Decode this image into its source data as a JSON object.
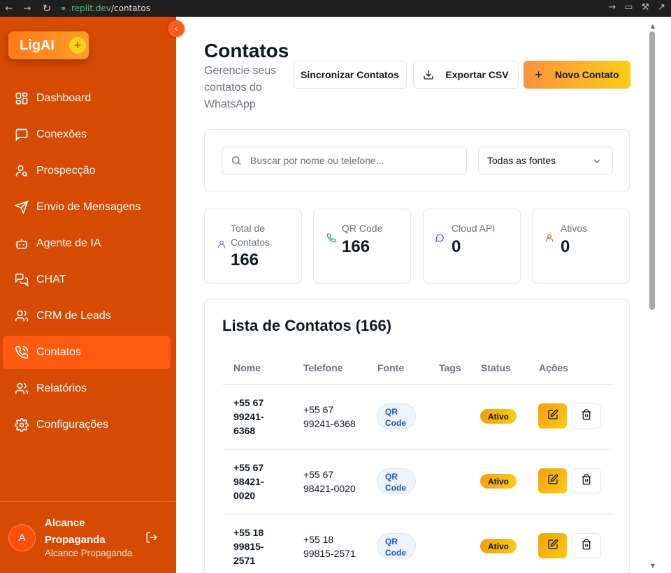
{
  "browser": {
    "url_domain": ".replit.dev",
    "url_path": "/contatos"
  },
  "sidebar": {
    "logo_text": "LigAI",
    "logo_badge": "+",
    "items": [
      {
        "label": "Dashboard",
        "icon": "layout-grid-icon"
      },
      {
        "label": "Conexões",
        "icon": "message-square-icon"
      },
      {
        "label": "Prospecção",
        "icon": "user-search-icon"
      },
      {
        "label": "Envio de Mensagens",
        "icon": "send-icon"
      },
      {
        "label": "Agente de IA",
        "icon": "bot-icon"
      },
      {
        "label": "CHAT",
        "icon": "messages-icon"
      },
      {
        "label": "CRM de Leads",
        "icon": "users-icon"
      },
      {
        "label": "Contatos",
        "icon": "phone-call-icon",
        "active": true
      },
      {
        "label": "Relatórios",
        "icon": "users-report-icon"
      },
      {
        "label": "Configurações",
        "icon": "gear-icon"
      }
    ],
    "user": {
      "initial": "A",
      "name": "Alcance Propaganda",
      "subtitle": "Alcance Propaganda"
    }
  },
  "header": {
    "title": "Contatos",
    "subtitle": "Gerencie seus contatos do WhatsApp",
    "btn_sync": "Sincronizar Contatos",
    "btn_csv": "Exportar CSV",
    "btn_new": "Novo Contato"
  },
  "filters": {
    "search_placeholder": "Buscar por nome ou telefone...",
    "source_selected": "Todas as fontes"
  },
  "stats": [
    {
      "label": "Total de Contatos",
      "value": "166",
      "color": "#3b82f6"
    },
    {
      "label": "QR Code",
      "value": "166",
      "color": "#16a34a"
    },
    {
      "label": "Cloud API",
      "value": "0",
      "color": "#9333ea"
    },
    {
      "label": "Ativos",
      "value": "0",
      "color": "#ea580c"
    }
  ],
  "list": {
    "title": "Lista de Contatos (166)",
    "columns": {
      "nome": "Nome",
      "telefone": "Telefone",
      "fonte": "Fonte",
      "tags": "Tags",
      "status": "Status",
      "acoes": "Ações"
    },
    "rows": [
      {
        "nome": "+55 67 99241-6368",
        "telefone": "+55 67 99241-6368",
        "fonte": "QR Code",
        "status": "Ativo"
      },
      {
        "nome": "+55 67 98421-0020",
        "telefone": "+55 67 98421-0020",
        "fonte": "QR Code",
        "status": "Ativo"
      },
      {
        "nome": "+55 18 99815-2571",
        "telefone": "+55 18 99815-2571",
        "fonte": "QR Code",
        "status": "Ativo"
      }
    ]
  },
  "colors": {
    "sidebar_bg": "#d64a02",
    "active_item": "#ff5a0f",
    "accent_gradient_start": "#fb923c",
    "accent_gradient_end": "#facc15"
  }
}
